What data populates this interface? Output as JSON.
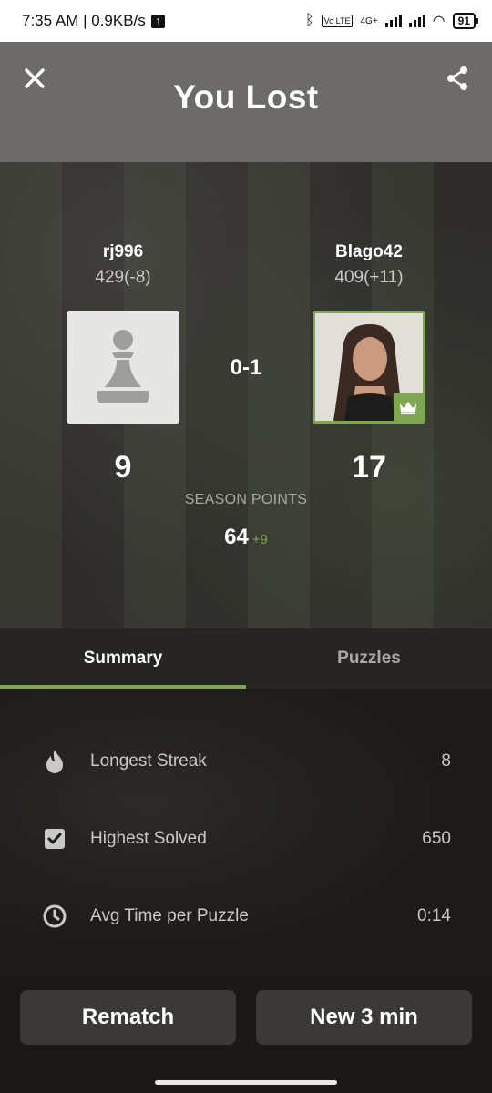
{
  "status_bar": {
    "time_speed": "7:35 AM | 0.9KB/s",
    "volte": "Vo LTE",
    "network": "4G+",
    "battery": "91"
  },
  "header": {
    "title": "You Lost"
  },
  "players": {
    "left": {
      "name": "rj996",
      "rating": "429(-8)",
      "season_points": "9"
    },
    "right": {
      "name": "Blago42",
      "rating": "409(+11)",
      "season_points": "17"
    }
  },
  "result": {
    "score": "0-1",
    "season_label": "SEASON POINTS",
    "season_total": "64",
    "season_delta": "+9"
  },
  "tabs": [
    {
      "label": "Summary",
      "active": true
    },
    {
      "label": "Puzzles",
      "active": false
    }
  ],
  "stats": [
    {
      "icon": "flame-icon",
      "label": "Longest Streak",
      "value": "8"
    },
    {
      "icon": "checkbox-icon",
      "label": "Highest Solved",
      "value": "650"
    },
    {
      "icon": "clock-icon",
      "label": "Avg Time per Puzzle",
      "value": "0:14"
    }
  ],
  "buttons": {
    "rematch": "Rematch",
    "new_game": "New 3 min"
  },
  "colors": {
    "accent": "#7fa650",
    "header_bg": "#6c6b69"
  }
}
